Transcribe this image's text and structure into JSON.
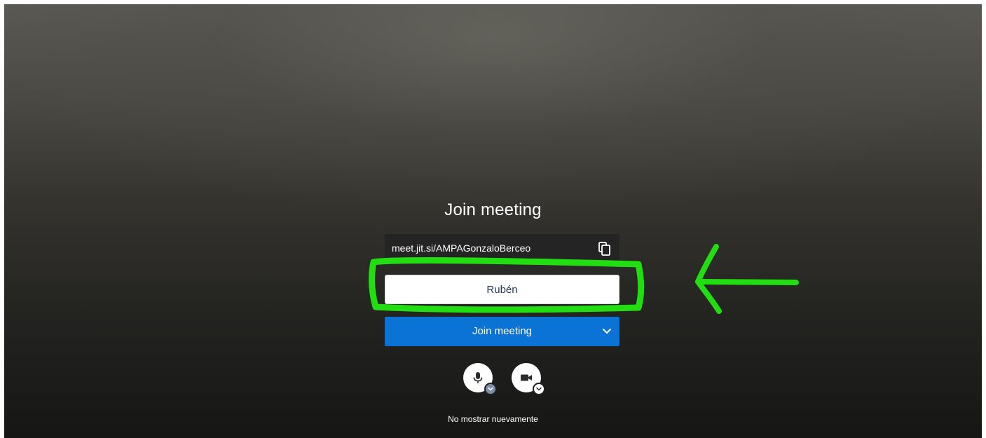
{
  "prejoin": {
    "title": "Join meeting",
    "meeting_url": "meet.jit.si/AMPAGonzaloBerceo",
    "name_value": "Rubén",
    "join_label": "Join meeting",
    "dont_show_again": "No mostrar nuevamente"
  },
  "icons": {
    "copy": "copy-icon",
    "options": "chevron-down-icon",
    "microphone": "microphone-icon",
    "camera": "camera-icon"
  },
  "colors": {
    "join_button": "#0b72d6",
    "annotation": "#22dd11",
    "mic_badge": "#7d8fa8",
    "cam_badge": "#ffffff"
  }
}
